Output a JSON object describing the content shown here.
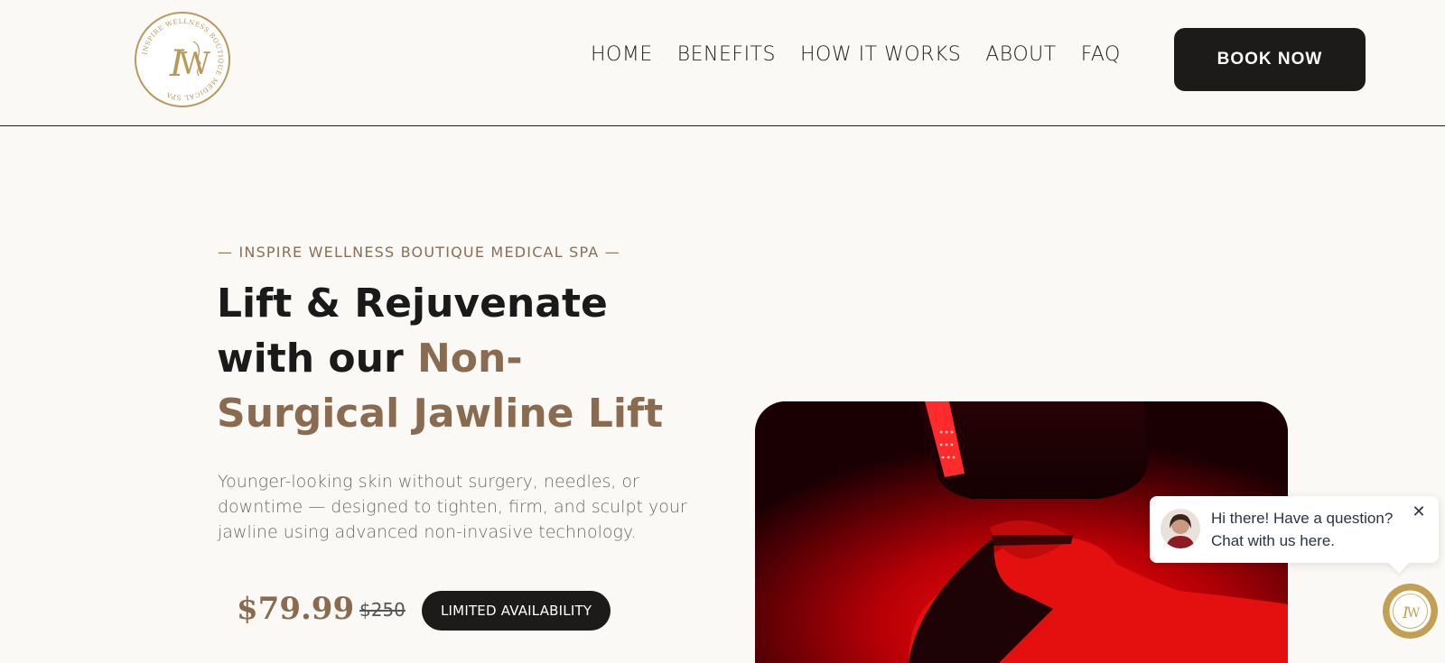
{
  "brand": {
    "name": "INSPIRE WELLNESS BOUTIQUE MEDICAL SPA",
    "monogram": "IW",
    "accent_color": "#8a6b4f",
    "gold_color": "#c39f53"
  },
  "nav": {
    "items": [
      "HOME",
      "BENEFITS",
      "HOW IT WORKS",
      "ABOUT",
      "FAQ"
    ],
    "cta_label": "BOOK NOW"
  },
  "hero": {
    "eyebrow": "— INSPIRE WELLNESS BOUTIQUE MEDICAL SPA —",
    "headline_part1": "Lift & Rejuvenate with our ",
    "headline_accent": "Non-Surgical Jawline Lift",
    "subcopy": "Younger-looking skin without surgery, needles, or downtime — designed to tighten, firm, and sculpt your jawline using advanced non-invasive technology.",
    "price": "$79.99",
    "old_price": "$250",
    "badge": "LIMITED AVAILABILITY",
    "image_icon": "red-light-therapy-photo"
  },
  "chat": {
    "message": "Hi there! Have a question? Chat with us here.",
    "close_icon": "close-icon",
    "launcher_icon": "iw-monogram-icon"
  }
}
